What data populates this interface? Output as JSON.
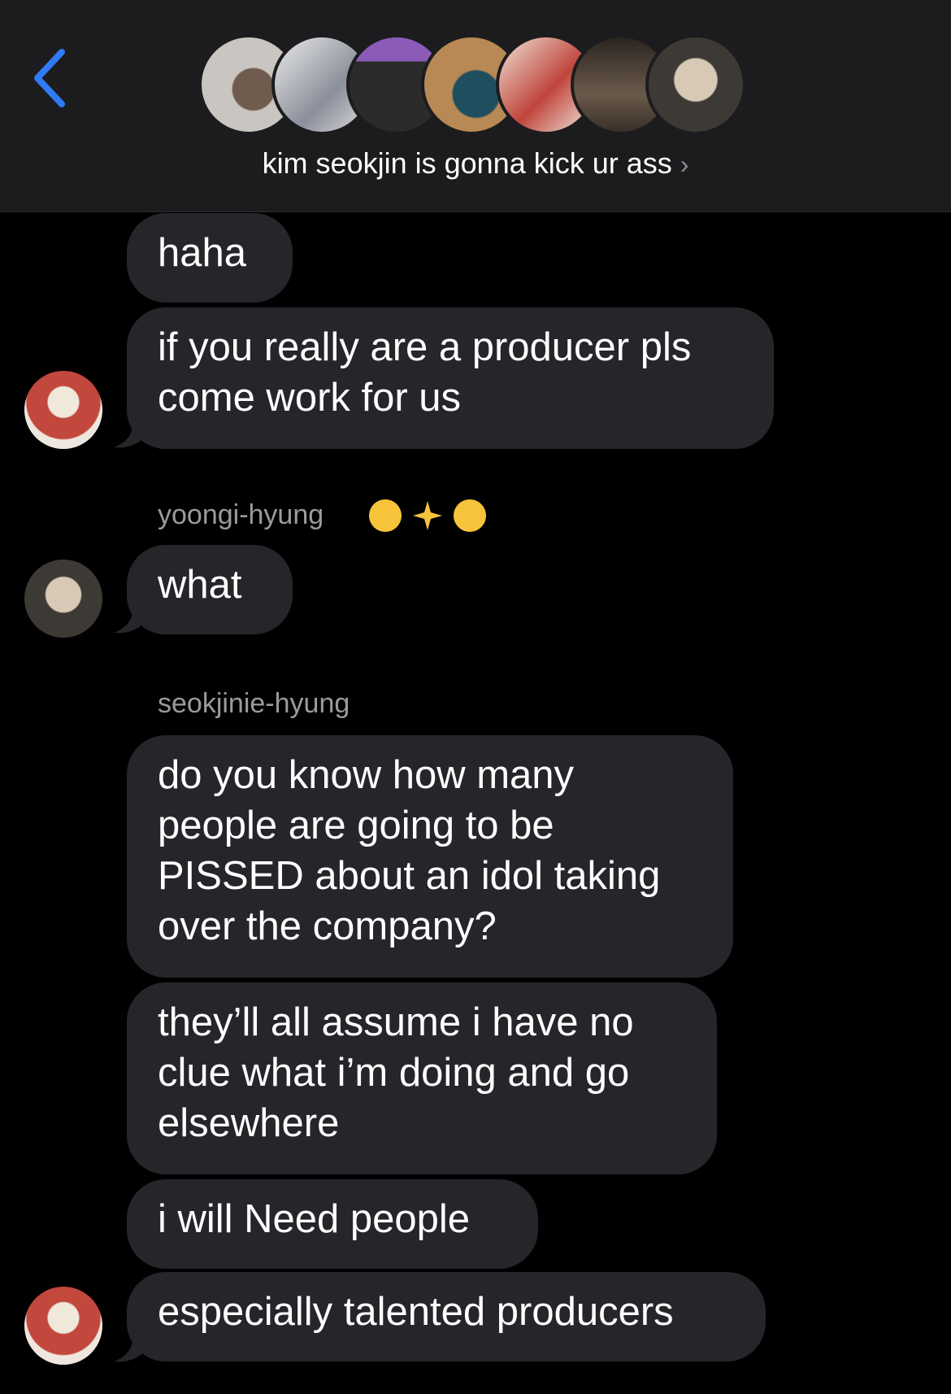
{
  "header": {
    "title": "kim seokjin is gonna kick ur ass",
    "chevron": "›",
    "back_icon": "chevron-left-icon",
    "accent": "#2f7bf5"
  },
  "messages": {
    "m1": "haha",
    "m2": "if you really are a producer pls\ncome work for us",
    "sender_yoongi": "yoongi-hyung",
    "m3": "what",
    "sender_seokjin": "seokjinie-hyung",
    "m4": "do you know how many\npeople are going to be\nPISSED about an idol taking\nover the company?",
    "m5": "they’ll all assume i have no\nclue what i’m doing and go\nelsewhere",
    "m6": "i will Need people",
    "m7": "especially talented producers"
  },
  "colors": {
    "background": "#000000",
    "header_bg": "#1c1c1e",
    "bubble": "#26252a",
    "sender_text": "#9a9a9f"
  }
}
